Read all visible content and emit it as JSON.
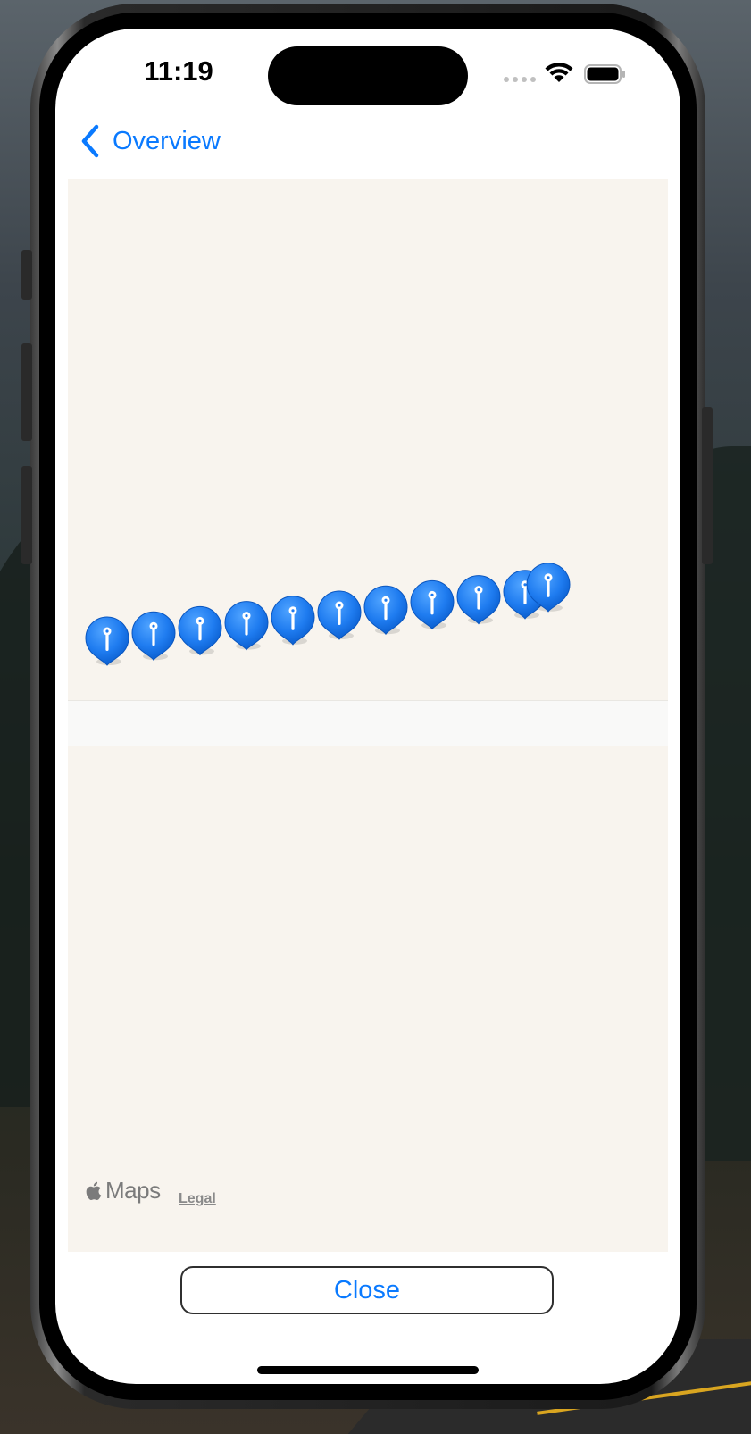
{
  "status_bar": {
    "time": "11:19"
  },
  "nav": {
    "back_label": "Overview"
  },
  "map": {
    "pin_count": 11,
    "pin_color": "#1f7cf0",
    "background_color": "#f8f4ee",
    "attribution": {
      "brand": "Maps",
      "legal_label": "Legal"
    }
  },
  "actions": {
    "close_label": "Close"
  },
  "colors": {
    "accent": "#0a7aff"
  }
}
